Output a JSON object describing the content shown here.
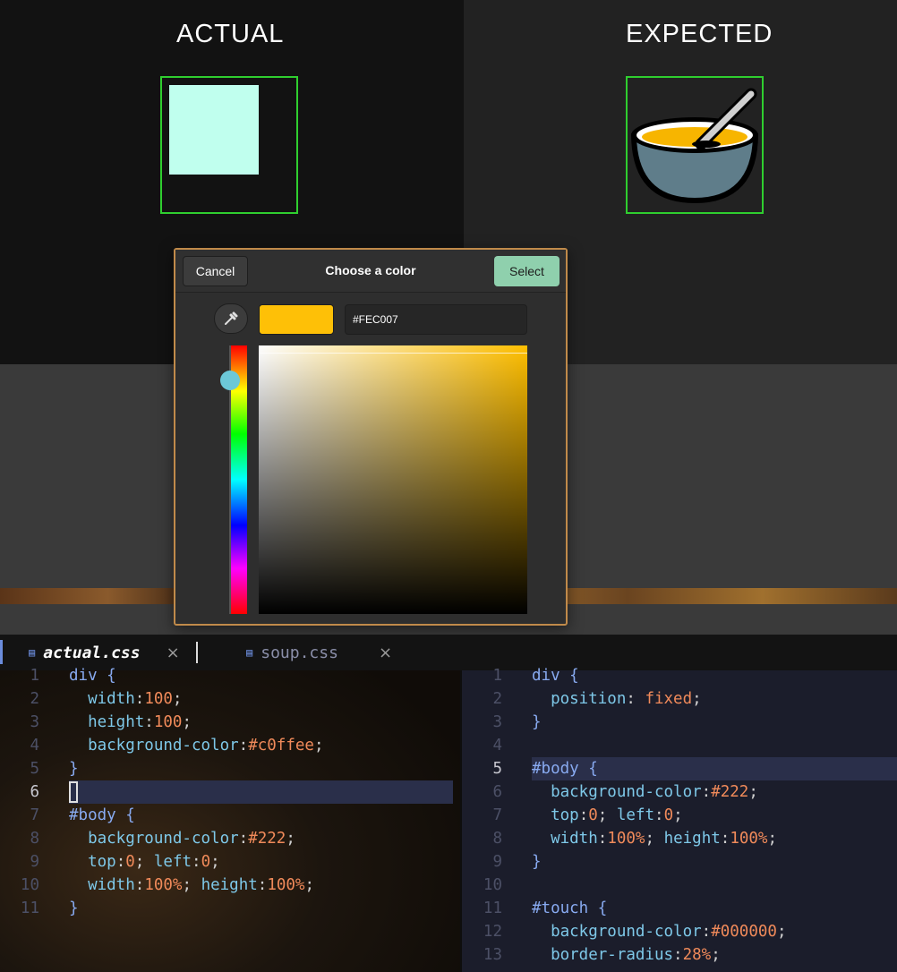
{
  "preview": {
    "actual_title": "ACTUAL",
    "expected_title": "EXPECTED",
    "actual_square_color": "#c0ffee",
    "frame_color": "#2fce2f",
    "expected_icon": "soup-bowl-icon"
  },
  "color_dialog": {
    "cancel_label": "Cancel",
    "title": "Choose a color",
    "select_label": "Select",
    "hex_value": "#FEC007",
    "current_color": "#FEC007",
    "eyedropper_icon": "eyedropper-icon"
  },
  "editor": {
    "tabs": [
      {
        "label": "actual.css",
        "icon": "css-file-icon",
        "active": true
      },
      {
        "label": "soup.css",
        "icon": "css-file-icon",
        "active": false
      }
    ],
    "close_glyph": "×",
    "left_pane": {
      "active_line": 6,
      "lines": [
        "div {",
        "  width:100;",
        "  height:100;",
        "  background-color:#c0ffee;",
        "}",
        "",
        "#body {",
        "  background-color:#222;",
        "  top:0; left:0;",
        "  width:100%; height:100%;",
        "}"
      ]
    },
    "right_pane": {
      "active_line": 5,
      "lines": [
        "div {",
        "  position: fixed;",
        "}",
        "",
        "#body {",
        "  background-color:#222;",
        "  top:0; left:0;",
        "  width:100%; height:100%;",
        "}",
        "",
        "#touch {",
        "  background-color:#000000;",
        "  border-radius:28%;"
      ]
    }
  }
}
